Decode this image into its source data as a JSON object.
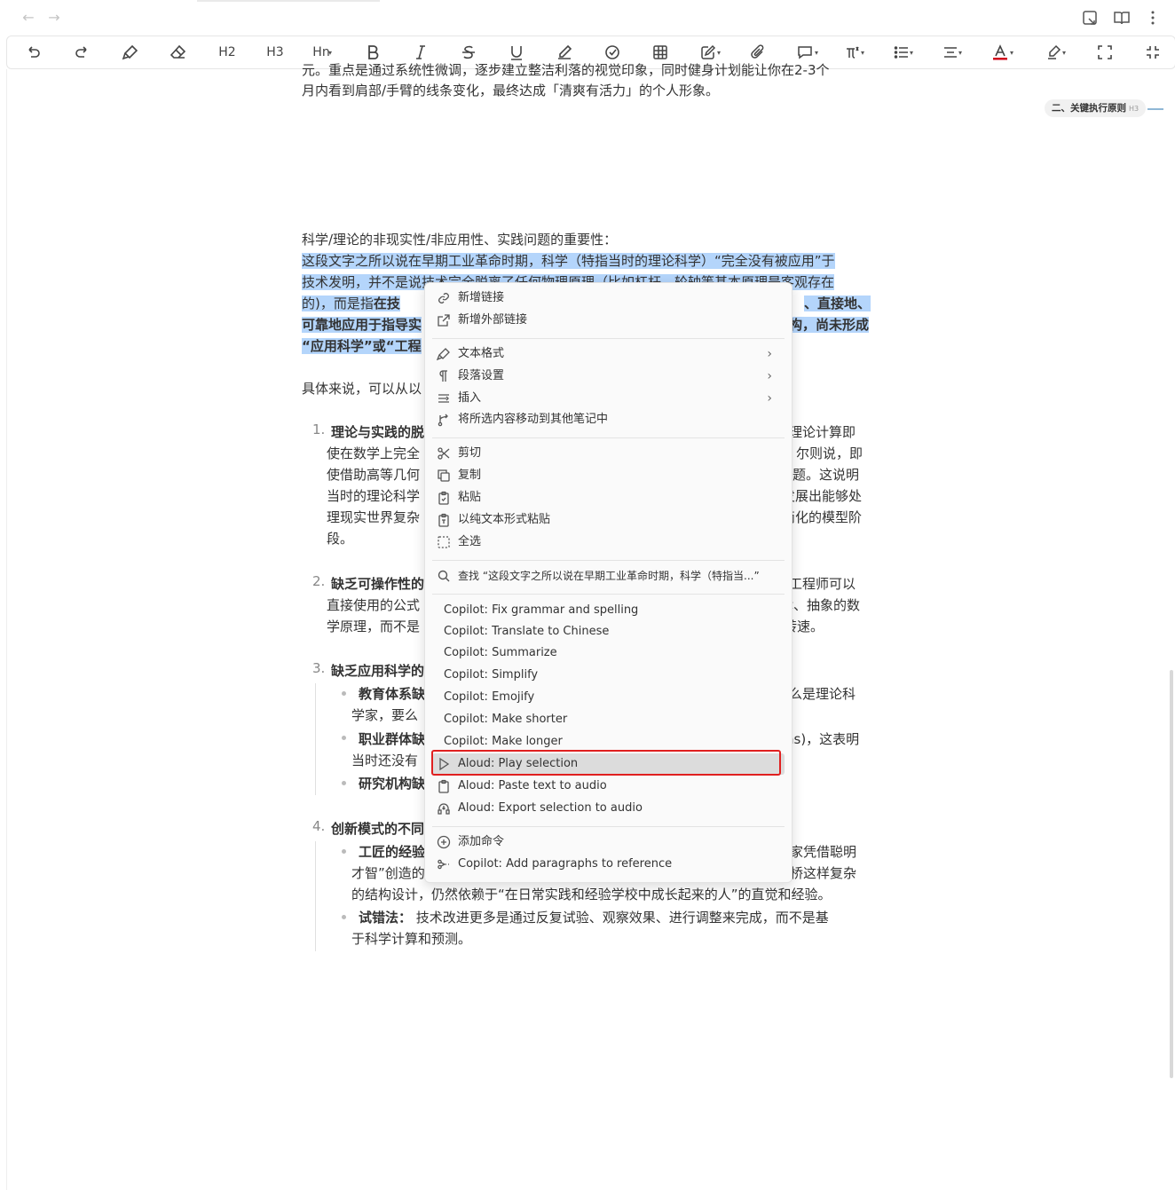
{
  "toolbar": {
    "h2": "H2",
    "h3": "H3",
    "hn": "Hn",
    "icons": [
      "undo-icon",
      "redo-icon",
      "format-painter-icon",
      "eraser-icon",
      "heading2",
      "heading3",
      "heading-n",
      "bold-icon",
      "italic-icon",
      "strikethrough-icon",
      "underline-icon",
      "highlight-pen-icon",
      "task-check-icon",
      "table-icon",
      "edit-icon",
      "attachment-icon",
      "comment-icon",
      "formula-icon",
      "list-icon",
      "align-icon",
      "font-color-icon",
      "highlight-color-icon",
      "fullscreen-icon",
      "collapse-icon"
    ]
  },
  "outline": {
    "label": "二、关键执行原则",
    "level": "H3"
  },
  "doc": {
    "top_line1": "元。重点是通过系统性微调，逐步建立整洁利落的视觉印象，同时健身计划能让你在2-3个",
    "top_line2": "月内看到肩部/手臂的线条变化，最终达成「清爽有活力」的个人形象。",
    "heading_line": "科学/理论的非现实性/非应用性、实践问题的重要性：",
    "sel1": "这段文字之所以说在早期工业革命时期，科学（特指当时的理论科学）“完全没有被应用”于",
    "sel2a": "技术发明，并不是说技术完全脱离了任何物理原理（比如杠杆、轮轴等基本原理是客观存在",
    "sel3a": "的)，而是指",
    "sel3b": "在技",
    "sel3c": "、直接地、",
    "sel4a": "可靠地应用于指导实",
    "sel4b": "构，尚未形成",
    "sel5a": "“应用科学”或“工程",
    "intro": "具体来说，可以从以",
    "item1_num": "1.",
    "item1_title": "理论与实践的脱",
    "item1_r1": "理论计算即",
    "item1_l2": "使在数学上完全",
    "item1_r2": "尔则说，即",
    "item1_l3": "使借助高等几何",
    "item1_r3": "题。这说明",
    "item1_l4": "当时的理论科学",
    "item1_r4": "发展出能够处",
    "item1_l5": "理现实世界复杂",
    "item1_r5": "简化的模型阶",
    "item1_l6": "段。",
    "item2_num": "2.",
    "item2_title": "缺乏可操作性的",
    "item2_r1": "工程师可以",
    "item2_l2": "直接使用的公式",
    "item2_r2": "律、抽象的数",
    "item2_l3": "学原理，而不是",
    "item2_r3": "转速。",
    "item3_num": "3.",
    "item3_title": "缺乏应用科学的",
    "item3_b1": "教育体系缺",
    "item3_b1r": "么是理论科",
    "item3_b1l2": "学家，要么",
    "item3_b2": "职业群体缺",
    "item3_b2r": "ns)，这表明",
    "item3_b2l2": "当时还没有",
    "item3_b3": "研究机构缺",
    "item4_num": "4.",
    "item4_title": "创新模式的不同",
    "item4_b1": "工匠的经验",
    "item4_b1r": "业家凭借聪明",
    "item4_b1l2": "才智”创造的",
    "item4_b1r2": "铁桥这样复杂",
    "item4_b1l3": "的结构设计，仍然依赖于“在日常实践和经验学校中成长起来的人”的直觉和经验。",
    "item4_b2_title": "试错法：",
    "item4_b2_text": " 技术改进更多是通过反复试验、观察效果、进行调整来完成，而不是基",
    "item4_b2l2": "于科学计算和预测。"
  },
  "menu": {
    "add_link": "新增链接",
    "add_external_link": "新增外部链接",
    "text_format": "文本格式",
    "paragraph_settings": "段落设置",
    "insert": "插入",
    "move_to_note": "将所选内容移动到其他笔记中",
    "cut": "剪切",
    "copy": "复制",
    "paste": "粘贴",
    "paste_plain": "以纯文本形式粘贴",
    "select_all": "全选",
    "find": "查找 “这段文字之所以说在早期工业革命时期，科学（特指当...”",
    "copilot_grammar": "Copilot: Fix grammar and spelling",
    "copilot_translate": "Copilot: Translate to Chinese",
    "copilot_summarize": "Copilot: Summarize",
    "copilot_simplify": "Copilot: Simplify",
    "copilot_emojify": "Copilot: Emojify",
    "copilot_shorter": "Copilot: Make shorter",
    "copilot_longer": "Copilot: Make longer",
    "aloud_play": "Aloud: Play selection",
    "aloud_paste": "Aloud: Paste text to audio",
    "aloud_export": "Aloud: Export selection to audio",
    "add_command": "添加命令",
    "copilot_add_paragraphs": "Copilot: Add paragraphs to reference"
  },
  "colors": {
    "selection": "#b4d5fb",
    "highlight_box": "#e02020",
    "outline_line": "#8fb7d6",
    "font_color_bar": "#d0021b"
  }
}
